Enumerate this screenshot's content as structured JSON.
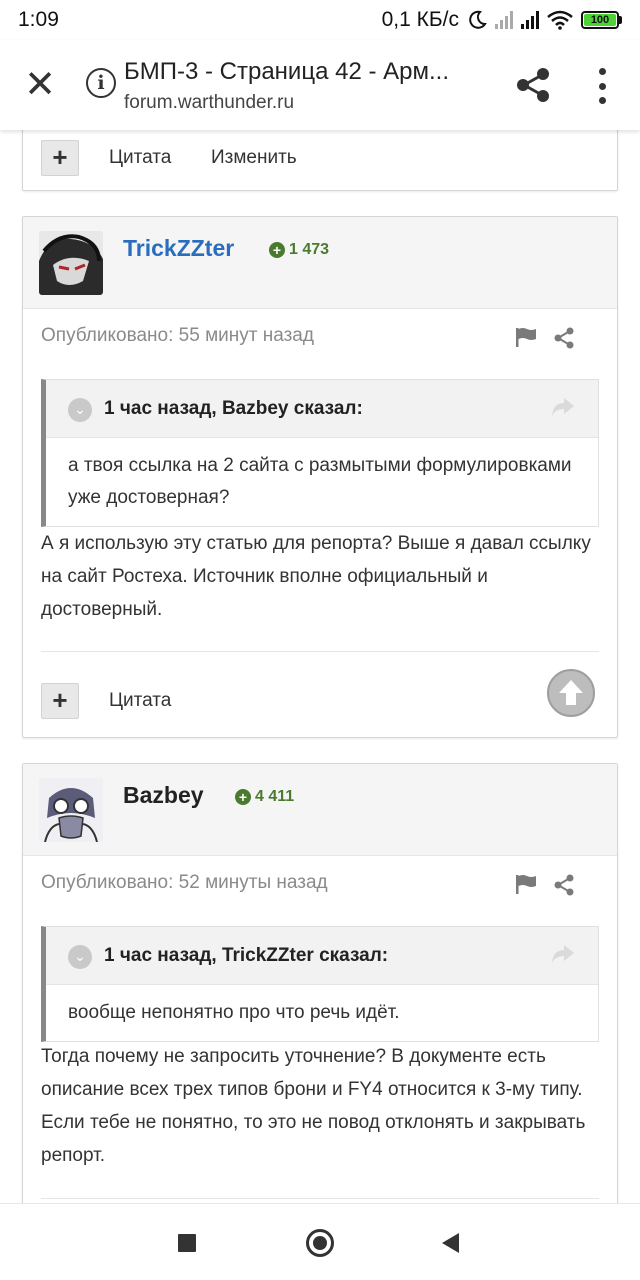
{
  "status_bar": {
    "time": "1:09",
    "net_speed": "0,1 КБ/с",
    "battery": "100"
  },
  "browser": {
    "page_title": "БМП-3 - Страница 42 - Арм...",
    "url": "forum.warthunder.ru",
    "close_icon": "close-icon",
    "info_icon": "info-icon",
    "share_icon": "share-icon",
    "menu_icon": "more-vert-icon"
  },
  "top_card": {
    "plus": "+",
    "quote_label": "Цитата",
    "edit_label": "Изменить"
  },
  "posts": [
    {
      "author": "TrickZZter",
      "author_color": "#2a6dbf",
      "reputation": "1 473",
      "published": "Опубликовано: 55 минут назад",
      "quote_cite": "1 час назад, Bazbey сказал:",
      "quote_text": "а твоя ссылка на 2 сайта с размытыми формулировками уже достоверная?",
      "text": "А я использую эту статью для репорта? Выше я давал ссылку на сайт Ростеха. Источник вполне официальный и достоверный.",
      "plus": "+",
      "quote_label": "Цитата"
    },
    {
      "author": "Bazbey",
      "author_color": "#222222",
      "reputation": "4 411",
      "published": "Опубликовано: 52 минуты назад",
      "quote_cite": "1 час назад, TrickZZter сказал:",
      "quote_text": "вообще непонятно про что речь идёт.",
      "text": "Тогда почему не запросить уточнение? В документе есть описание всех трех типов брони и FY4 относится к 3-му типу. Если тебе не понятно, то это не повод отклонять и закрывать репорт."
    }
  ],
  "colors": {
    "reputation_green": "#4b7a2f",
    "meta_gray": "#8a8a8a"
  }
}
